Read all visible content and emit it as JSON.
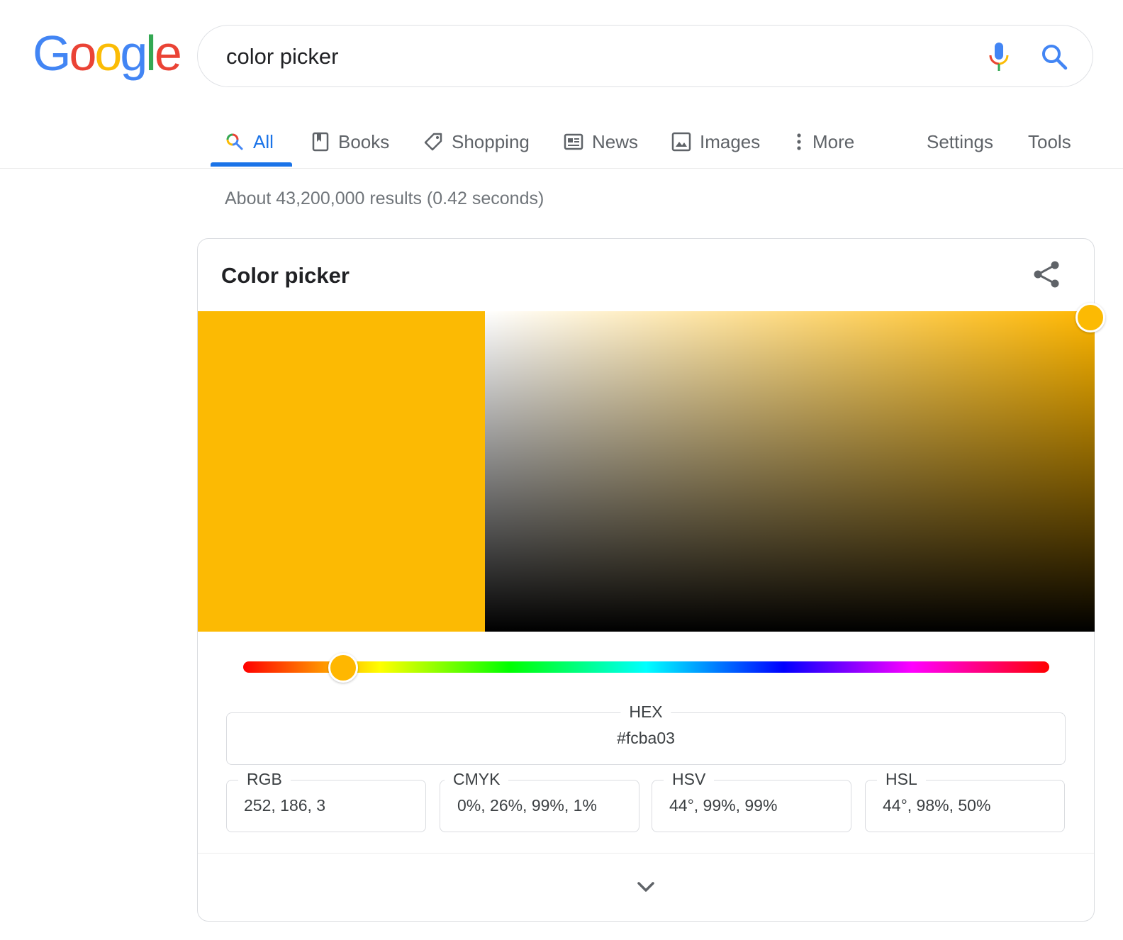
{
  "logo": {
    "letters": [
      "G",
      "o",
      "o",
      "g",
      "l",
      "e"
    ]
  },
  "search": {
    "value": "color picker"
  },
  "tabs": [
    {
      "label": "All",
      "icon": "search-icon"
    },
    {
      "label": "Books",
      "icon": "book-icon"
    },
    {
      "label": "Shopping",
      "icon": "tag-icon"
    },
    {
      "label": "News",
      "icon": "news-icon"
    },
    {
      "label": "Images",
      "icon": "image-icon"
    },
    {
      "label": "More",
      "icon": "more-vert-icon"
    },
    {
      "label": "Settings"
    },
    {
      "label": "Tools"
    }
  ],
  "result_stats": "About 43,200,000 results (0.42 seconds)",
  "color_picker": {
    "title": "Color picker",
    "selected_color": "#fcba03",
    "hue_color": "#ffb700",
    "hue_fraction": 0.12,
    "saturation": 0.99,
    "value": 0.99,
    "hex": {
      "label": "HEX",
      "value": "#fcba03"
    },
    "rgb": {
      "label": "RGB",
      "value": "252, 186, 3"
    },
    "cmyk": {
      "label": "CMYK",
      "value": "0%, 26%, 99%, 1%"
    },
    "hsv": {
      "label": "HSV",
      "value": "44°, 99%, 99%"
    },
    "hsl": {
      "label": "HSL",
      "value": "44°, 98%, 50%"
    }
  },
  "colors": {
    "google_blue": "#4285f4",
    "google_red": "#ea4335",
    "google_yellow": "#fbbc05",
    "google_green": "#34a853",
    "accent": "#1a73e8"
  }
}
